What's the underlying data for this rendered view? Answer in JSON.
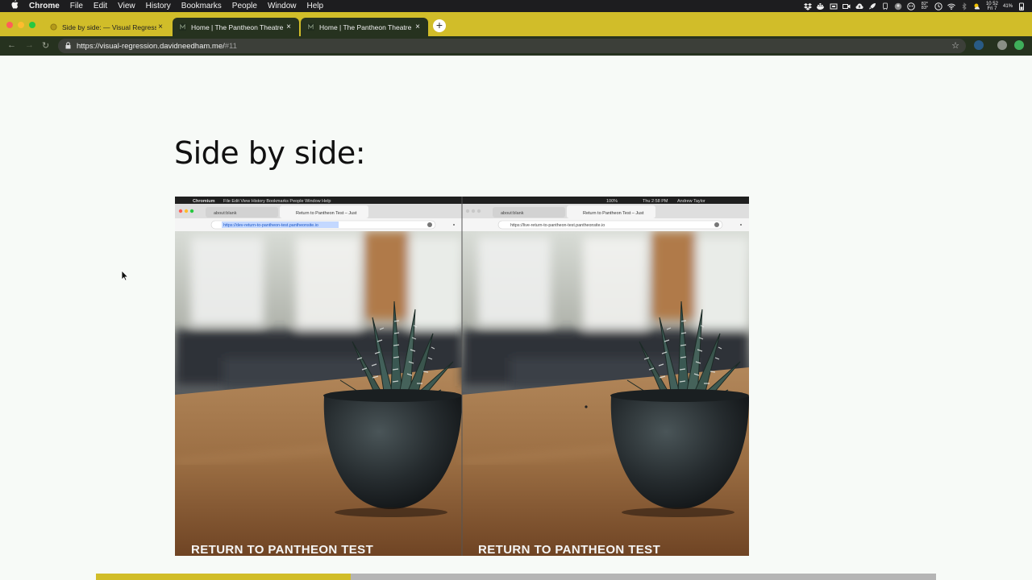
{
  "menubar": {
    "app": "Chrome",
    "items": [
      "File",
      "Edit",
      "View",
      "History",
      "Bookmarks",
      "People",
      "Window",
      "Help"
    ],
    "clock_line1": "10 52",
    "clock_line2": "Fri 7",
    "temp_line1": "82°",
    "temp_line2": "83°",
    "battery": "41%"
  },
  "tabs": [
    {
      "title": "Side by side: — Visual Regressi",
      "active": true
    },
    {
      "title": "Home | The Pantheon Theatre",
      "active": false
    },
    {
      "title": "Home | The Pantheon Theatre",
      "active": false
    }
  ],
  "omnibox": {
    "url_main": "https://visual-regression.davidneedham.me/",
    "url_hash": "#11"
  },
  "slide": {
    "heading": "Side by side:",
    "left_caption": "RETURN TO PANTHEON TEST",
    "right_caption": "RETURN TO PANTHEON TEST",
    "left_url": "https://dev-return-to-pantheon-test.pantheonsite.io",
    "right_url": "https://live-return-to-pantheon-test.pantheonsite.io",
    "inner_tab1": "about:blank",
    "inner_tab2": "Return to Pantheon Test – Just",
    "inner_app": "Chromium",
    "inner_menu": [
      "File",
      "Edit",
      "View",
      "History",
      "Bookmarks",
      "People",
      "Window",
      "Help"
    ],
    "inner_time": "Thu 2:58 PM",
    "inner_user": "Andrew Taylor",
    "inner_battery": "100%"
  },
  "presentation": {
    "progress_fraction": 0.303
  },
  "colors": {
    "accent": "#d1bd29",
    "toolbar": "#26321f",
    "page_bg": "#f7faf7"
  }
}
